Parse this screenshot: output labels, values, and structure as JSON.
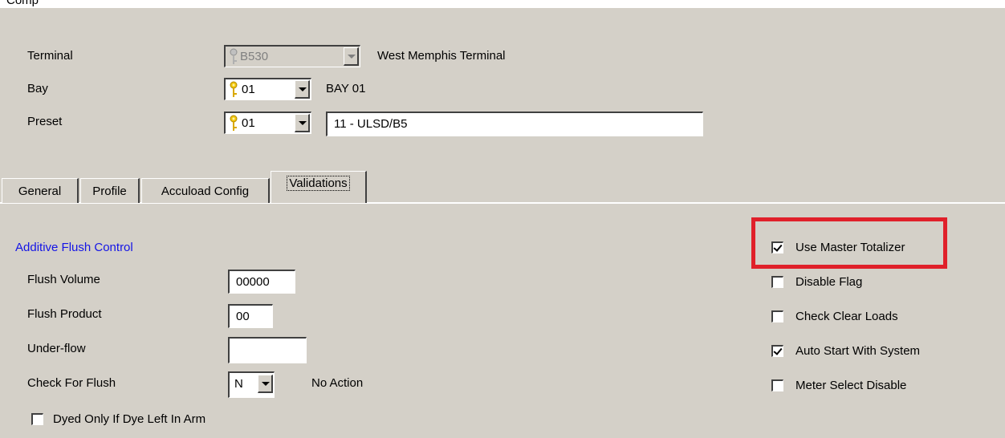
{
  "top": {
    "partial_text": "Comp"
  },
  "header": {
    "terminal": {
      "label": "Terminal",
      "code": "B530",
      "name": "West Memphis Terminal"
    },
    "bay": {
      "label": "Bay",
      "code": "01",
      "name": "BAY 01"
    },
    "preset": {
      "label": "Preset",
      "code": "01",
      "name": "11 - ULSD/B5"
    }
  },
  "tabs": [
    {
      "label": "General"
    },
    {
      "label": "Profile"
    },
    {
      "label": "Accuload Config"
    },
    {
      "label": "Validations"
    }
  ],
  "flush": {
    "section_title": "Additive Flush Control",
    "volume": {
      "label": "Flush Volume",
      "value": "00000"
    },
    "product": {
      "label": "Flush Product",
      "value": "00"
    },
    "underflow": {
      "label": "Under-flow",
      "value": ""
    },
    "check": {
      "label": "Check For Flush",
      "value": "N",
      "description": "No Action"
    },
    "dyed_only": {
      "label": "Dyed Only If Dye Left In Arm",
      "checked": false
    }
  },
  "options": [
    {
      "label": "Use Master Totalizer",
      "checked": true
    },
    {
      "label": "Disable Flag",
      "checked": false
    },
    {
      "label": "Check Clear Loads",
      "checked": false
    },
    {
      "label": "Auto Start With System",
      "checked": true
    },
    {
      "label": "Meter Select Disable",
      "checked": false
    }
  ],
  "colors": {
    "panel": "#d4d0c8",
    "section_title": "#1414e6",
    "highlight": "#e0202a"
  }
}
